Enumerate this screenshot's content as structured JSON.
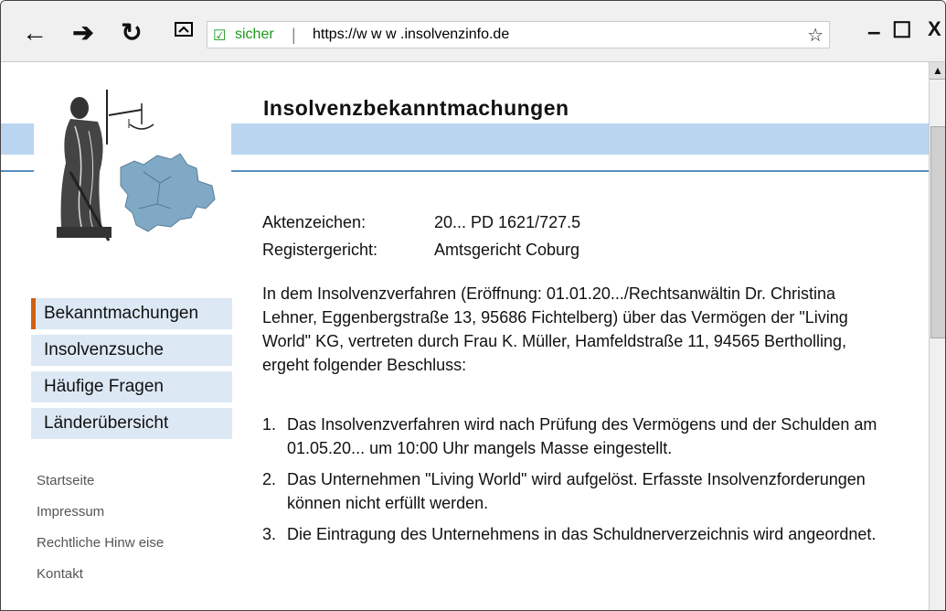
{
  "browser": {
    "back_icon": "←",
    "forward_icon": "➔",
    "reload_icon": "↻",
    "tabs_icon": "⏏",
    "lock_icon": "☑",
    "secure_label": "sicher",
    "separator": "|",
    "url": "https://w w w .insolvenzinfo.de",
    "star_icon": "☆",
    "minimize": "–",
    "maximize": "☐",
    "close": "X"
  },
  "page": {
    "title": "Insolvenzbekanntmachungen",
    "meta": [
      {
        "key": "Aktenzeichen:",
        "value": "20... PD 1621/727.5"
      },
      {
        "key": "Registergericht:",
        "value": "Amtsgericht Coburg"
      }
    ],
    "paragraph": "In dem Insolvenzverfahren (Eröffnung: 01.01.20.../Rechtsanwältin Dr. Christina Lehner, Eggenbergstraße 13, 95686 Fichtelberg) über das Vermögen der \"Living World\" KG, vertreten durch Frau K. Müller, Hamfeldstraße 11, 94565 Bertholling, ergeht folgender Beschluss:",
    "items": [
      {
        "num": "1.",
        "text": "Das Insolvenzverfahren wird nach Prüfung des Vermögens und der Schulden am 01.05.20... um 10:00 Uhr mangels Masse eingestellt."
      },
      {
        "num": "2.",
        "text": "Das Unternehmen \"Living World\" wird aufgelöst. Erfasste Insolvenzforderungen können nicht erfüllt werden."
      },
      {
        "num": "3.",
        "text": "Die Eintragung des Unternehmens in das Schuldnerverzeichnis wird angeordnet."
      }
    ]
  },
  "nav": {
    "items": [
      "Bekanntmachungen",
      "Insolvenzsuche",
      "Häufige Fragen",
      "Länderübersicht"
    ],
    "active": "Bekanntmachungen"
  },
  "links": [
    "Startseite",
    "Impressum",
    "Rechtliche Hinw eise",
    "Kontakt"
  ],
  "scrollbar": {
    "up_icon": "▲"
  },
  "colors": {
    "accent": "#d06010",
    "band": "#b9d5ef",
    "nav_bg": "#dce8f4",
    "secure": "#1a9a1a"
  }
}
